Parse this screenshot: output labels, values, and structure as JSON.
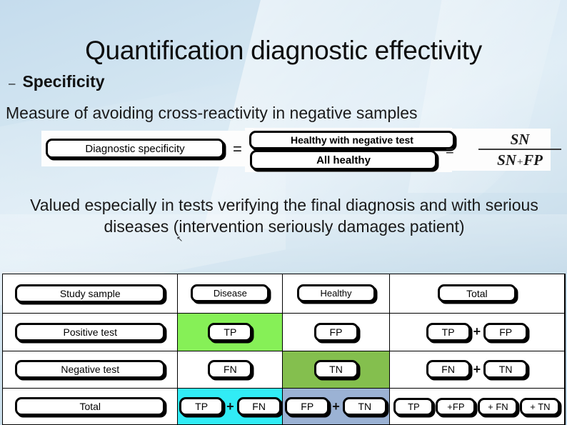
{
  "slide": {
    "title": "Quantification diagnostic effectivity",
    "bullet": {
      "dash": "–",
      "label": "Specificity"
    },
    "lead_line": "Measure of avoiding cross-reactivity in negative samples",
    "body_paragraph": "Valued especially in tests verifying the final diagnosis and with serious diseases (intervention seriously damages patient)"
  },
  "formula": {
    "left_term": "Diagnostic specificity",
    "equals": "=",
    "numerator": "Healthy with negative test",
    "denominator": "All healthy",
    "equals2": "=",
    "fraction": {
      "numerator": "SN",
      "denominator_left": "SN",
      "denominator_plus": "+",
      "denominator_right": "FP"
    }
  },
  "matrix": {
    "headers": {
      "study_sample": "Study sample",
      "disease": "Disease",
      "healthy": "Healthy",
      "total": "Total"
    },
    "rows": [
      {
        "label": "Positive test",
        "disease": "TP",
        "healthy": "FP",
        "total_left": "TP",
        "total_plus": "+",
        "total_right": "FP"
      },
      {
        "label": "Negative test",
        "disease": "FN",
        "healthy": "TN",
        "total_left": "FN",
        "total_plus": "+",
        "total_right": "TN"
      }
    ],
    "total_row": {
      "label": "Total",
      "disease_left": "TP",
      "disease_plus": "+",
      "disease_right": "FN",
      "healthy_left": "FP",
      "healthy_plus": "+",
      "healthy_right": "TN",
      "total_1": "TP",
      "total_2": "+FP",
      "total_3": "+ FN",
      "total_4": "+ TN"
    },
    "colors": {
      "true_positive": "#86f057",
      "true_negative": "#84bf4e",
      "disease_total": "#31ecf5",
      "healthy_total": "#9bb2d4"
    }
  }
}
